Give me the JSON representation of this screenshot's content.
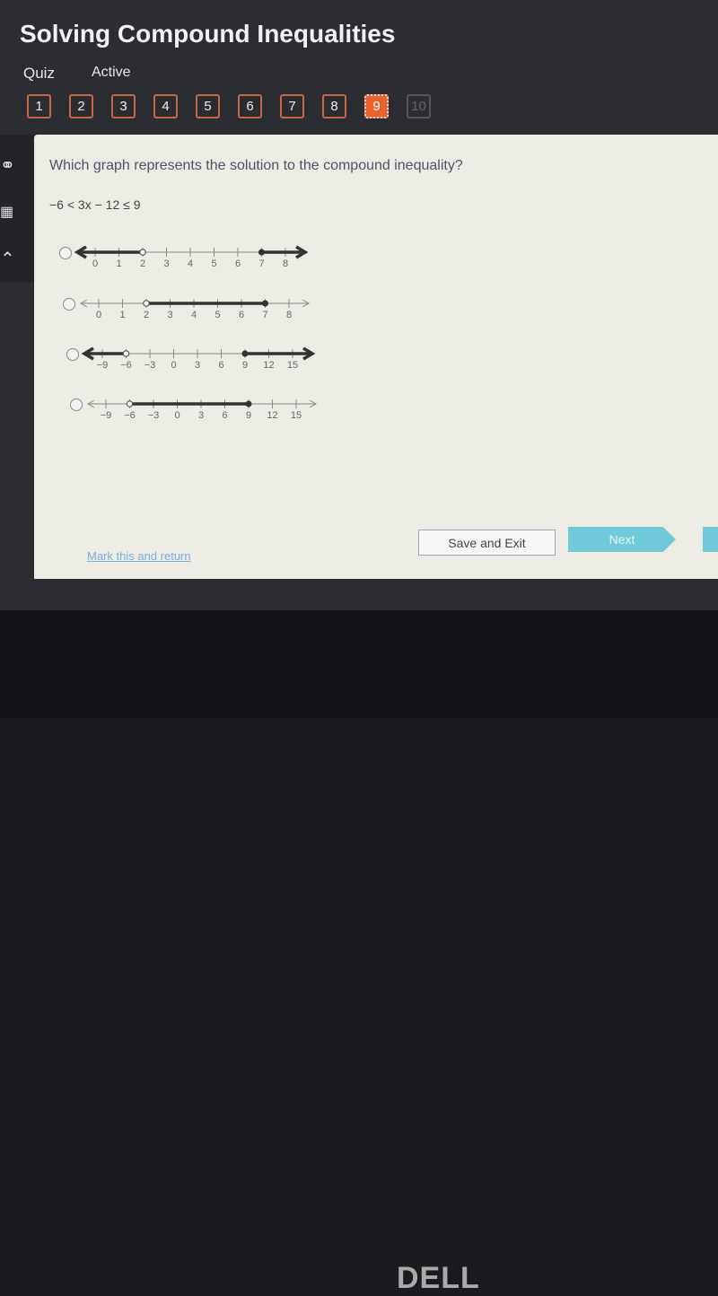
{
  "header": {
    "title": "Solving Compound Inequalities",
    "quiz_label": "Quiz",
    "status": "Active"
  },
  "question_nav": [
    {
      "label": "1",
      "state": "normal"
    },
    {
      "label": "2",
      "state": "normal"
    },
    {
      "label": "3",
      "state": "normal"
    },
    {
      "label": "4",
      "state": "normal"
    },
    {
      "label": "5",
      "state": "normal"
    },
    {
      "label": "6",
      "state": "normal"
    },
    {
      "label": "7",
      "state": "normal"
    },
    {
      "label": "8",
      "state": "normal"
    },
    {
      "label": "9",
      "state": "active"
    },
    {
      "label": "10",
      "state": "disabled"
    }
  ],
  "sidebar": {
    "icons": [
      "headphones-icon",
      "calculator-icon",
      "arrow-up-icon"
    ]
  },
  "question": {
    "prompt": "Which graph represents the solution to the compound inequality?",
    "inequality": "−6 < 3x − 12 ≤ 9"
  },
  "options": [
    {
      "ticks": [
        "0",
        "1",
        "2",
        "3",
        "4",
        "5",
        "6",
        "7",
        "8"
      ],
      "tick_values": [
        0,
        1,
        2,
        3,
        4,
        5,
        6,
        7,
        8
      ],
      "shading": "outside",
      "open_point": 2,
      "closed_point": 7
    },
    {
      "ticks": [
        "0",
        "1",
        "2",
        "3",
        "4",
        "5",
        "6",
        "7",
        "8"
      ],
      "tick_values": [
        0,
        1,
        2,
        3,
        4,
        5,
        6,
        7,
        8
      ],
      "shading": "between",
      "open_point": 2,
      "closed_point": 7
    },
    {
      "ticks": [
        "−9",
        "−6",
        "−3",
        "0",
        "3",
        "6",
        "9",
        "12",
        "15"
      ],
      "tick_values": [
        -9,
        -6,
        -3,
        0,
        3,
        6,
        9,
        12,
        15
      ],
      "shading": "outside",
      "open_point": -6,
      "closed_point": 9
    },
    {
      "ticks": [
        "−9",
        "−6",
        "−3",
        "0",
        "3",
        "6",
        "9",
        "12",
        "15"
      ],
      "tick_values": [
        -9,
        -6,
        -3,
        0,
        3,
        6,
        9,
        12,
        15
      ],
      "shading": "between",
      "open_point": -6,
      "closed_point": 9
    }
  ],
  "footer": {
    "mark_link": "Mark this and return",
    "save_label": "Save and Exit",
    "next_label": "Next"
  },
  "bezel": {
    "logo": "DELL"
  },
  "colors": {
    "accent": "#e8622e",
    "next": "#6fc9d8",
    "panel": "#ecebe4"
  }
}
